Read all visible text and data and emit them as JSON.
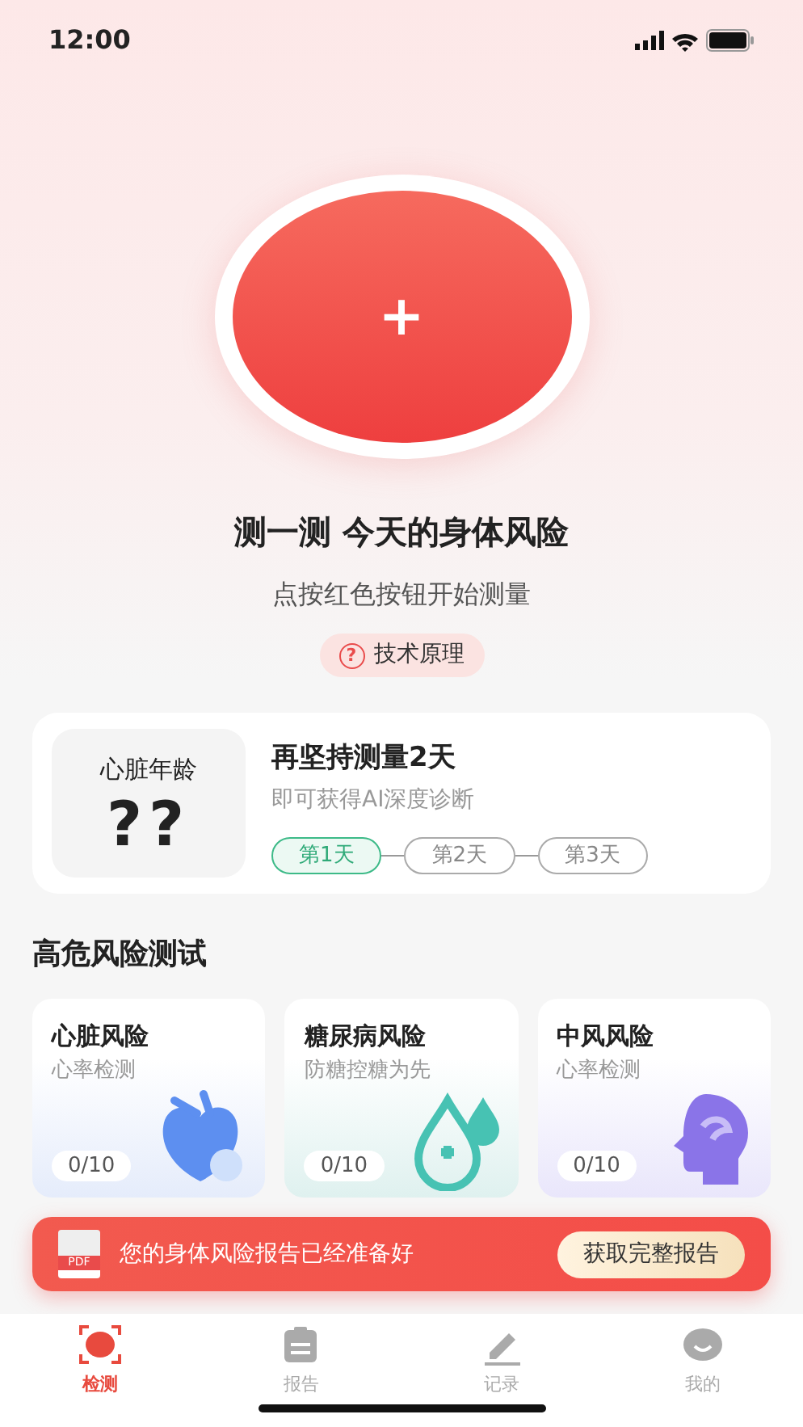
{
  "status_bar": {
    "time": "12:00"
  },
  "hero": {
    "button_symbol": "+",
    "title": "测一测 今天的身体风险",
    "subtitle": "点按红色按钮开始测量",
    "help_icon": "?",
    "help_label": "技术原理"
  },
  "heart_age_card": {
    "label": "心脏年龄",
    "value": "??",
    "title": "再坚持测量2天",
    "subtitle": "即可获得AI深度诊断",
    "steps": [
      {
        "label": "第1天",
        "selected": true
      },
      {
        "label": "第2天",
        "selected": false
      },
      {
        "label": "第3天",
        "selected": false
      }
    ]
  },
  "section_title": "高危风险测试",
  "risk_cards": [
    {
      "kind": "heart",
      "title": "心脏风险",
      "subtitle": "心率检测",
      "progress": "0/10"
    },
    {
      "kind": "diabetes",
      "title": "糖尿病风险",
      "subtitle": "防糖控糖为先",
      "progress": "0/10"
    },
    {
      "kind": "stroke",
      "title": "中风风险",
      "subtitle": "心率检测",
      "progress": "0/10"
    }
  ],
  "report_banner": {
    "icon_label": "PDF",
    "message": "您的身体风险报告已经准备好",
    "button": "获取完整报告"
  },
  "tab_bar": [
    {
      "kind": "detect",
      "label": "检测",
      "selected": true
    },
    {
      "kind": "report",
      "label": "报告",
      "selected": false
    },
    {
      "kind": "record",
      "label": "记录",
      "selected": false
    },
    {
      "kind": "me",
      "label": "我的",
      "selected": false
    }
  ]
}
